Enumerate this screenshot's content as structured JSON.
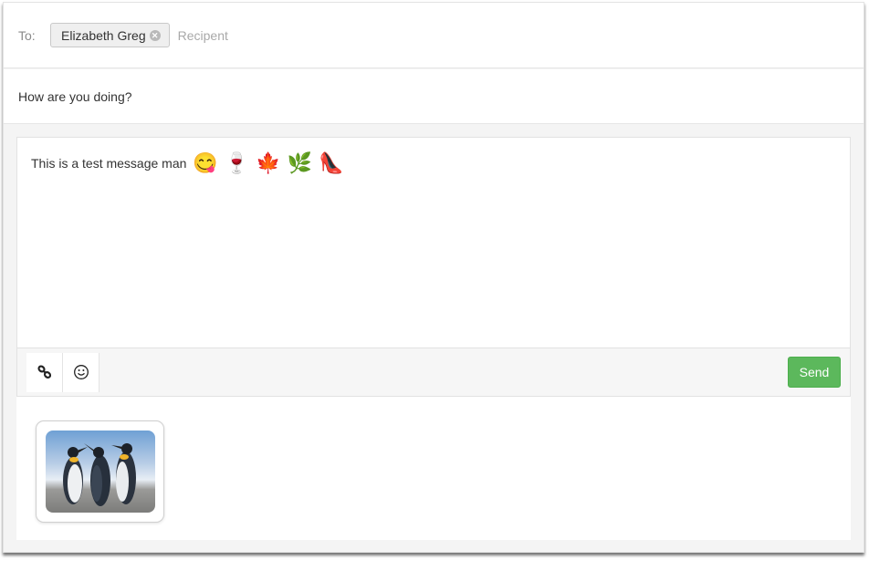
{
  "compose": {
    "to_label": "To:",
    "recipients": [
      {
        "name": "Elizabeth Greg",
        "remove_icon": "remove-circle-icon"
      }
    ],
    "recipient_placeholder": "Recipent",
    "subject": "How are you doing?",
    "message": {
      "text": "This is a test message man",
      "emojis": [
        {
          "name": "face-savoring-food",
          "glyph": "😋"
        },
        {
          "name": "wine-glass",
          "glyph": "🍷"
        },
        {
          "name": "maple-leaf",
          "glyph": "🍁"
        },
        {
          "name": "herb",
          "glyph": "🌿"
        },
        {
          "name": "high-heeled-shoe",
          "glyph": "👠"
        }
      ]
    },
    "toolbar": {
      "link_icon": "link-icon",
      "emoji_icon": "smiley-icon",
      "send_label": "Send",
      "send_color": "#5cb85c"
    },
    "attachments": [
      {
        "type": "image",
        "description": "penguins"
      }
    ]
  }
}
